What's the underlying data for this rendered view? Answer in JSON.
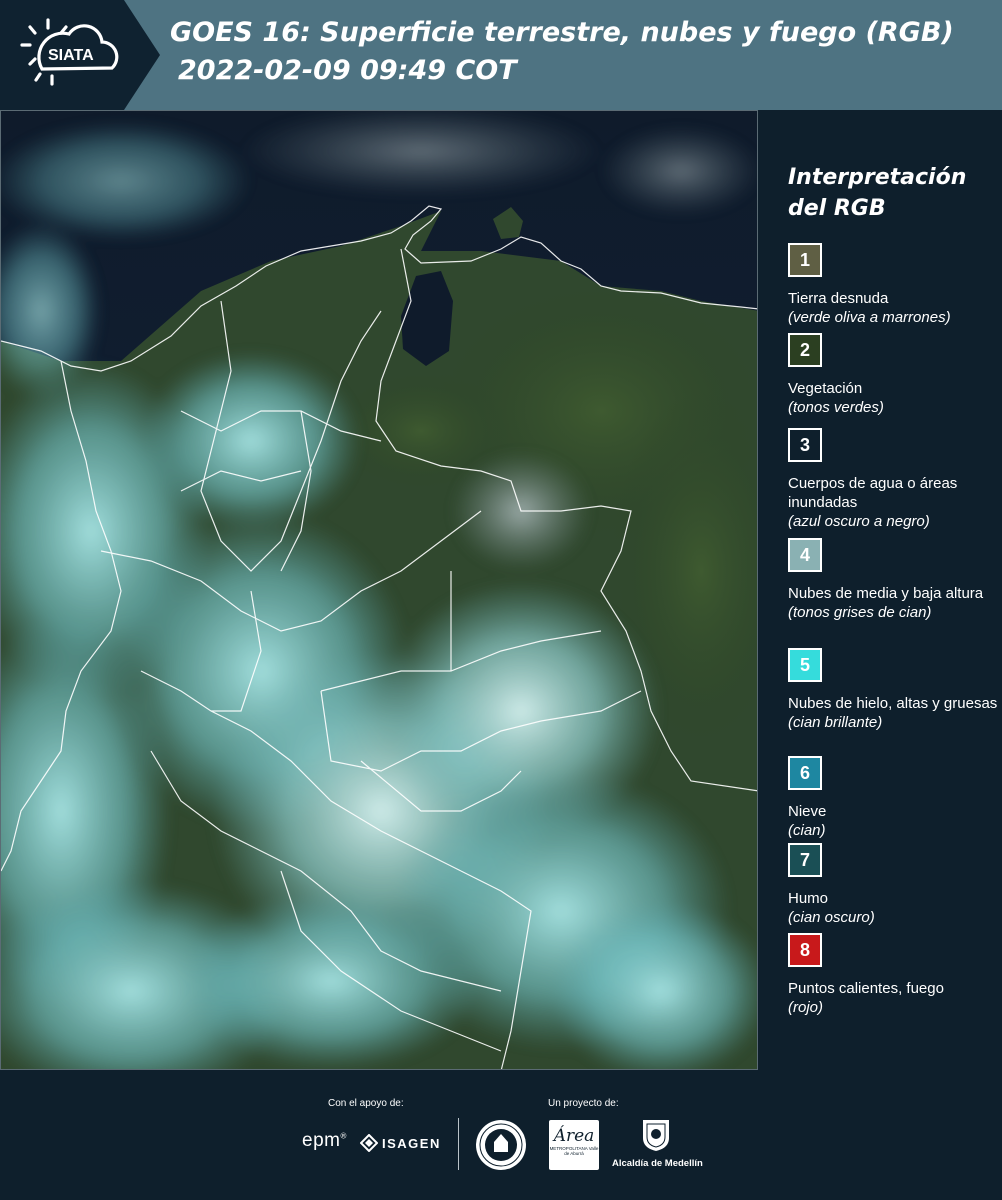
{
  "header": {
    "logo_text": "SIATA",
    "title_line1": "GOES 16: Superficie terrestre, nubes y fuego (RGB)",
    "title_line2": "2022-02-09 09:49 COT"
  },
  "legend": {
    "title": "Interpretación del RGB",
    "items": [
      {
        "number": "1",
        "label": "Tierra desnuda",
        "hint": "(verde oliva a marrones)",
        "color": "#5f5f44"
      },
      {
        "number": "2",
        "label": "Vegetación",
        "hint": "(tonos verdes)",
        "color": "#2b3f21"
      },
      {
        "number": "3",
        "label": "Cuerpos de agua o áreas inundadas",
        "hint": "(azul oscuro a negro)",
        "color": "#0e1f2c"
      },
      {
        "number": "4",
        "label": "Nubes de media y baja altura",
        "hint": "(tonos grises de cian)",
        "color": "#8ab1b3"
      },
      {
        "number": "5",
        "label": "Nubes de hielo, altas y gruesas",
        "hint": "(cian brillante)",
        "color": "#35dcdc"
      },
      {
        "number": "6",
        "label": "Nieve",
        "hint": "(cian)",
        "color": "#1e87a1"
      },
      {
        "number": "7",
        "label": "Humo",
        "hint": "(cian oscuro)",
        "color": "#1a4f55"
      },
      {
        "number": "8",
        "label": "Puntos calientes, fuego",
        "hint": "(rojo)",
        "color": "#c8191b"
      }
    ]
  },
  "footer": {
    "support_caption": "Con el apoyo de:",
    "project_caption": "Un proyecto de:",
    "epm_logo": "epm",
    "isagen_logo": "ISAGEN",
    "area_logo": "Área",
    "area_logo_sub": "METROPOLITANA Valle de Aburrá",
    "medellin_logo": "Alcaldía de Medellín"
  }
}
